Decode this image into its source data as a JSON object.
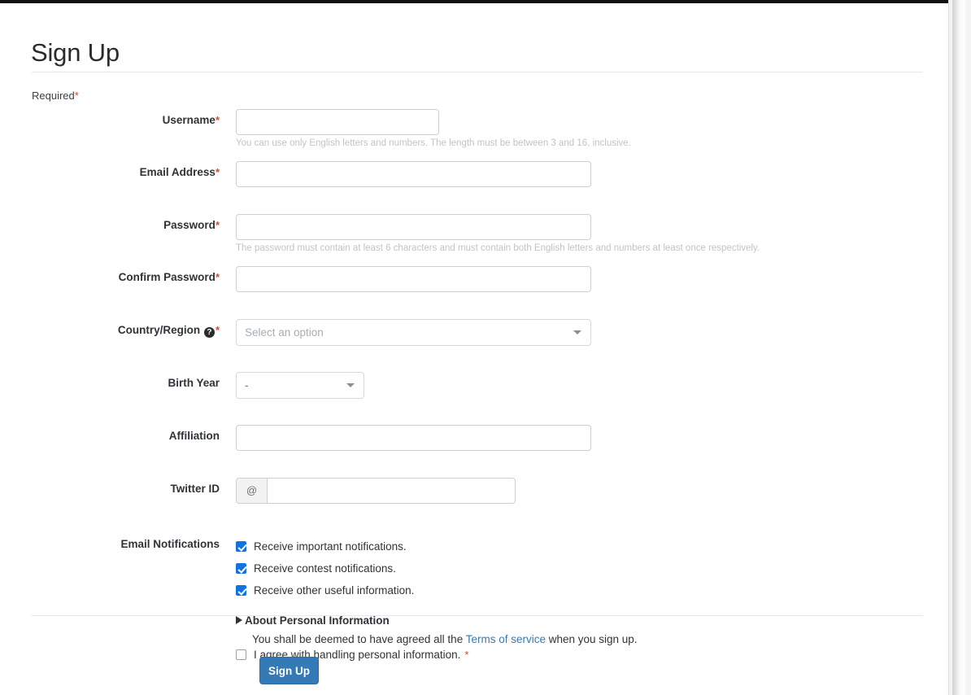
{
  "page": {
    "title": "Sign Up",
    "required_note": "Required",
    "required_marker": "*"
  },
  "form": {
    "username": {
      "label": "Username",
      "required": true,
      "value": "",
      "placeholder": "",
      "help": "You can use only English letters and numbers. The length must be between 3 and 16, inclusive."
    },
    "email": {
      "label": "Email Address",
      "required": true,
      "value": "",
      "placeholder": ""
    },
    "password": {
      "label": "Password",
      "required": true,
      "value": "",
      "placeholder": "",
      "help": "The password must contain at least 6 characters and must contain both English letters and numbers at least once respectively."
    },
    "confirm_password": {
      "label": "Confirm Password",
      "required": true,
      "value": "",
      "placeholder": ""
    },
    "country": {
      "label": "Country/Region",
      "required": true,
      "help_icon": "question-mark-icon",
      "selected": "Select an option"
    },
    "birth_year": {
      "label": "Birth Year",
      "required": false,
      "selected": "-"
    },
    "affiliation": {
      "label": "Affiliation",
      "required": false,
      "value": "",
      "placeholder": ""
    },
    "twitter": {
      "label": "Twitter ID",
      "required": false,
      "prefix": "@",
      "value": "",
      "placeholder": ""
    },
    "email_notifications": {
      "label": "Email Notifications",
      "options": [
        {
          "label": "Receive important notifications.",
          "checked": true
        },
        {
          "label": "Receive contest notifications.",
          "checked": true
        },
        {
          "label": "Receive other useful information.",
          "checked": true
        }
      ]
    },
    "personal_info": {
      "disclosure_label": "About Personal Information",
      "disclosure_expanded": false,
      "agree_label": "I agree with handling personal information.",
      "agree_checked": false,
      "agree_required_marker": "*"
    }
  },
  "footer": {
    "terms_prefix": "You shall be deemed to have agreed all the ",
    "terms_link": "Terms of service",
    "terms_suffix": " when you sign up.",
    "submit_label": "Sign Up"
  },
  "colors": {
    "accent_blue": "#337ab7",
    "checkbox_blue": "#1272e3",
    "required_red": "#e8442c",
    "link_blue": "#337ab7"
  }
}
